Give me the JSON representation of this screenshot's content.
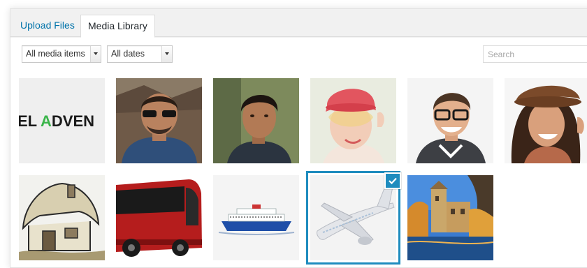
{
  "tabs": [
    {
      "label": "Upload Files",
      "active": false
    },
    {
      "label": "Media Library",
      "active": true
    }
  ],
  "filters": {
    "media_type": "All media items",
    "dates": "All dates"
  },
  "search": {
    "placeholder": "Search",
    "value": ""
  },
  "logo_text": {
    "prefix": "EL ",
    "accent": "A",
    "suffix": "DVEN",
    "accent_color": "#3ab54a"
  },
  "attachments": [
    {
      "content": "logo-text",
      "selected": false
    },
    {
      "content": "man-with-sunglasses",
      "selected": false
    },
    {
      "content": "young-man-portrait",
      "selected": false
    },
    {
      "content": "woman-red-hat",
      "selected": false
    },
    {
      "content": "man-with-glasses",
      "selected": false
    },
    {
      "content": "woman-brown-hat",
      "selected": false
    },
    {
      "content": "cottage-sketch",
      "selected": false
    },
    {
      "content": "red-bus",
      "selected": false
    },
    {
      "content": "ferry-boat",
      "selected": false
    },
    {
      "content": "airplane",
      "selected": true
    },
    {
      "content": "castle-autumn",
      "selected": false
    }
  ],
  "colors": {
    "link": "#0073aa",
    "selection": "#1e8cbe",
    "chrome_bg": "#f1f1f1"
  }
}
